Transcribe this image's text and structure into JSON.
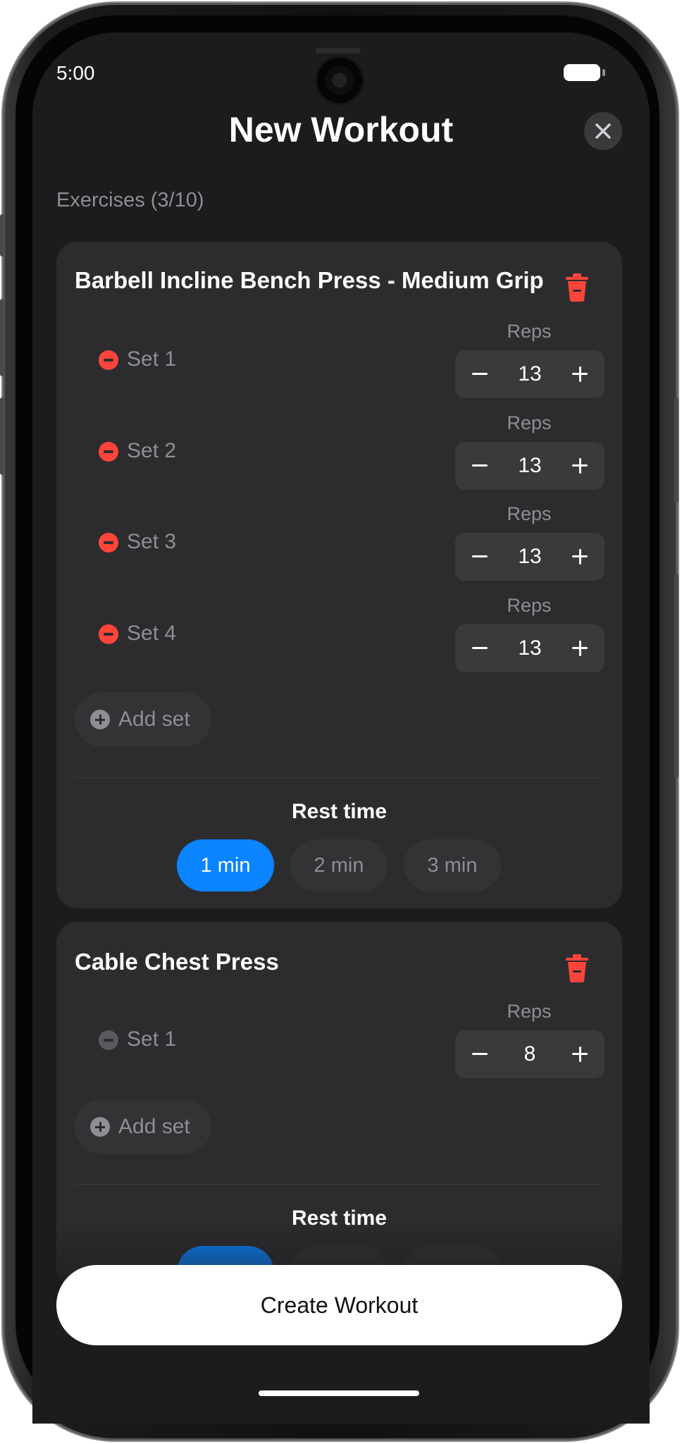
{
  "status_bar": {
    "time": "5:00"
  },
  "header": {
    "title": "New Workout"
  },
  "exercises_label": "Exercises (3/10)",
  "exercises": [
    {
      "name": "Barbell Incline Bench Press - Medium Grip",
      "sets": [
        {
          "label": "Set 1",
          "reps_label": "Reps",
          "reps": "13"
        },
        {
          "label": "Set 2",
          "reps_label": "Reps",
          "reps": "13"
        },
        {
          "label": "Set 3",
          "reps_label": "Reps",
          "reps": "13"
        },
        {
          "label": "Set 4",
          "reps_label": "Reps",
          "reps": "13"
        }
      ],
      "add_set_label": "Add set",
      "rest_time_label": "Rest time",
      "rest_options": [
        "1 min",
        "2 min",
        "3 min"
      ],
      "rest_selected": "1 min"
    },
    {
      "name": "Cable Chest Press",
      "sets": [
        {
          "label": "Set 1",
          "reps_label": "Reps",
          "reps": "8"
        }
      ],
      "add_set_label": "Add set",
      "rest_time_label": "Rest time"
    }
  ],
  "footer": {
    "create_label": "Create Workout"
  },
  "colors": {
    "accent": "#0a84ff",
    "danger": "#ff453a",
    "background": "#1c1c1e",
    "card": "#2c2c2e"
  },
  "icons": [
    "close-icon",
    "trash-icon",
    "minus-circle-icon",
    "plus-circle-icon",
    "minus-icon",
    "plus-icon",
    "battery-icon",
    "camera-icon"
  ]
}
